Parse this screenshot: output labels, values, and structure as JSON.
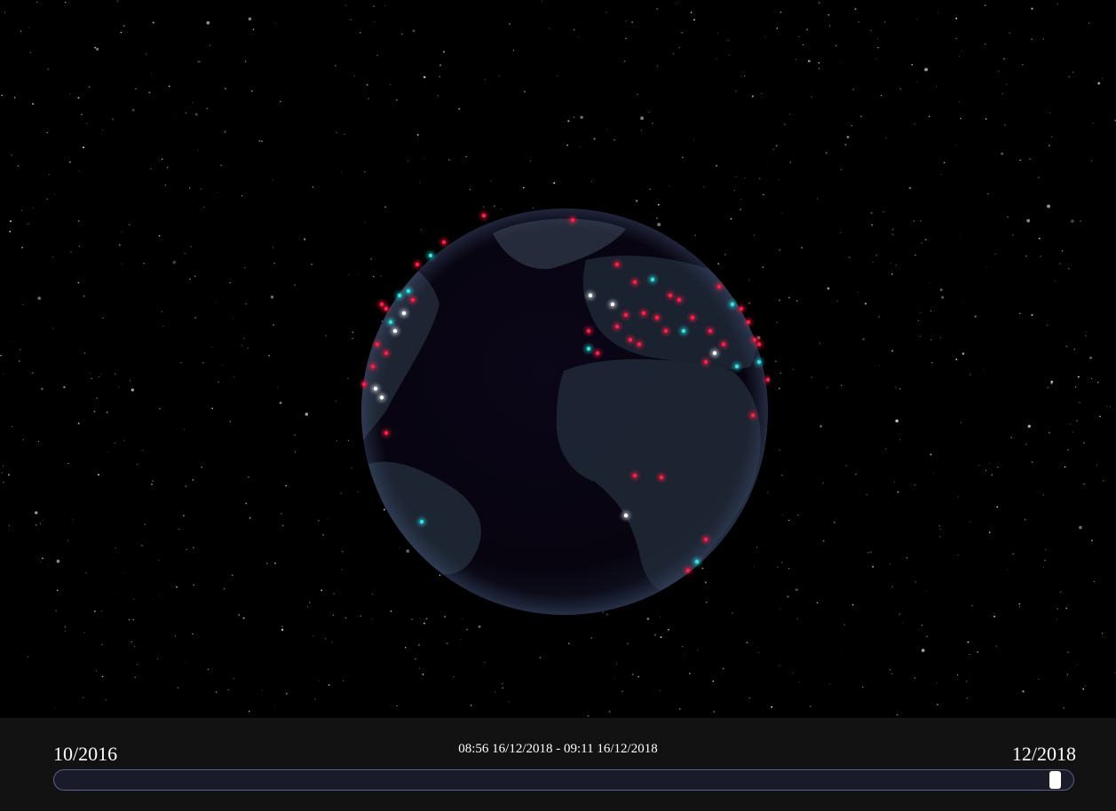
{
  "timeline": {
    "start_label": "10/2016",
    "end_label": "12/2018",
    "range_label": "08:56 16/12/2018 - 09:11 16/12/2018",
    "position": 0.99
  },
  "colors": {
    "background": "#000000",
    "panel": "#121212",
    "track_border": "#5a5f8c",
    "handle": "#ffffff",
    "event_red": "#ff1e46",
    "event_cyan": "#2ee6e6",
    "event_white": "#ffffff"
  },
  "globe": {
    "legend": []
  }
}
